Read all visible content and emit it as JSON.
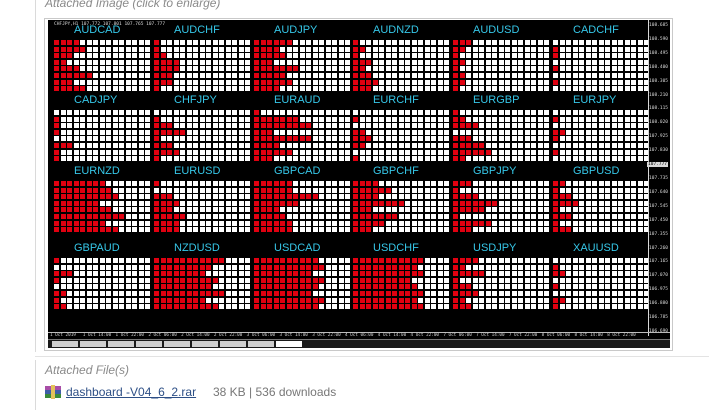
{
  "captions": {
    "attached_image": "Attached Image (click to enlarge)",
    "attached_files": "Attached File(s)"
  },
  "chart": {
    "header": "CHFJPY,H1  107.772 107.801 107.765 107.777",
    "price_ticks": [
      "108.685",
      "108.590",
      "108.495",
      "108.400",
      "108.305",
      "108.210",
      "108.115",
      "108.020",
      "107.925",
      "107.830",
      "107.777",
      "107.735",
      "107.640",
      "107.545",
      "107.450",
      "107.355",
      "107.260",
      "107.165",
      "107.070",
      "106.975",
      "106.880",
      "106.785",
      "106.690"
    ],
    "highlight_tick": "107.777",
    "time_ticks": [
      "1 Oct 2019",
      "1 Oct 14:00",
      "1 Oct 22:00",
      "2 Oct 06:00",
      "2 Oct 14:00",
      "2 Oct 22:00",
      "3 Oct 06:00",
      "3 Oct 14:00",
      "3 Oct 22:00",
      "4 Oct 06:00",
      "4 Oct 14:00",
      "4 Oct 22:00",
      "7 Oct 06:00",
      "7 Oct 14:00",
      "7 Oct 22:00",
      "8 Oct 06:00",
      "8 Oct 14:00",
      "8 Oct 22:00"
    ],
    "tab_count": 9,
    "panels": [
      {
        "label": "AUDCAD",
        "reds": [
          4,
          5,
          3,
          2,
          4,
          6,
          3,
          5
        ]
      },
      {
        "label": "AUDCHF",
        "reds": [
          1,
          1,
          2,
          4,
          4,
          3,
          3,
          1
        ]
      },
      {
        "label": "AUDJPY",
        "reds": [
          6,
          4,
          5,
          3,
          7,
          5,
          6,
          4
        ]
      },
      {
        "label": "AUDNZD",
        "reds": [
          1,
          2,
          1,
          3,
          2,
          3,
          4,
          3
        ]
      },
      {
        "label": "AUDUSD",
        "reds": [
          3,
          2,
          1,
          2,
          1,
          2,
          2,
          1
        ]
      },
      {
        "label": "CADCHF",
        "reds": [
          0,
          1,
          1,
          0,
          1,
          0,
          1,
          0
        ]
      },
      {
        "label": "CADJPY",
        "reds": [
          0,
          1,
          1,
          1,
          0,
          3,
          1,
          1
        ]
      },
      {
        "label": "CHFJPY",
        "reds": [
          0,
          1,
          3,
          5,
          1,
          3,
          4,
          1
        ]
      },
      {
        "label": "EURAUD",
        "reds": [
          1,
          7,
          9,
          3,
          9,
          4,
          6,
          3
        ]
      },
      {
        "label": "EURCHF",
        "reds": [
          0,
          1,
          0,
          2,
          3,
          2,
          0,
          1
        ]
      },
      {
        "label": "EURGBP",
        "reds": [
          1,
          2,
          4,
          0,
          3,
          5,
          6,
          2
        ]
      },
      {
        "label": "EURJPY",
        "reds": [
          0,
          1,
          0,
          2,
          1,
          0,
          1,
          0
        ]
      },
      {
        "label": "EURNZD",
        "reds": [
          8,
          9,
          10,
          7,
          9,
          11,
          8,
          10
        ]
      },
      {
        "label": "EURUSD",
        "reds": [
          1,
          0,
          3,
          4,
          3,
          5,
          4,
          4
        ]
      },
      {
        "label": "GBPCAD",
        "reds": [
          6,
          6,
          10,
          7,
          4,
          5,
          6,
          6
        ]
      },
      {
        "label": "GBPCHF",
        "reds": [
          4,
          6,
          4,
          8,
          3,
          7,
          5,
          3
        ]
      },
      {
        "label": "GBPJPY",
        "reds": [
          3,
          1,
          4,
          7,
          5,
          1,
          6,
          3
        ]
      },
      {
        "label": "GBPUSD",
        "reds": [
          2,
          1,
          3,
          4,
          1,
          3,
          1,
          3
        ]
      },
      {
        "label": "GBPAUD",
        "reds": [
          1,
          0,
          3,
          1,
          0,
          2,
          1,
          2
        ]
      },
      {
        "label": "NZDUSD",
        "reds": [
          11,
          9,
          8,
          10,
          9,
          11,
          8,
          10
        ]
      },
      {
        "label": "USDCAD",
        "reds": [
          10,
          11,
          9,
          11,
          10,
          9,
          11,
          10
        ]
      },
      {
        "label": "USDCHF",
        "reds": [
          11,
          10,
          11,
          9,
          10,
          11,
          10,
          11
        ]
      },
      {
        "label": "USDJPY",
        "reds": [
          4,
          2,
          5,
          1,
          3,
          4,
          2,
          3
        ]
      },
      {
        "label": "XAUUSD",
        "reds": [
          0,
          1,
          2,
          0,
          1,
          0,
          2,
          1
        ]
      }
    ]
  },
  "attachment": {
    "icon": "winrar-archive-icon",
    "file_name": "dashboard -V04_6_2.rar",
    "meta": "38 KB  |  536 downloads"
  }
}
